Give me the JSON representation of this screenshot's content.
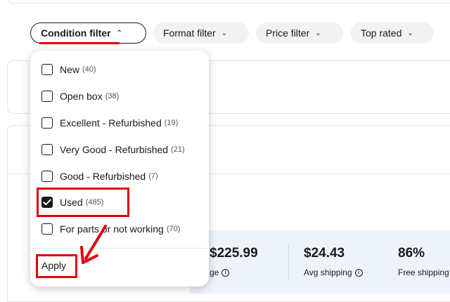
{
  "filters": [
    {
      "label": "Condition filter",
      "active": true
    },
    {
      "label": "Format filter",
      "active": false
    },
    {
      "label": "Price filter",
      "active": false
    },
    {
      "label": "Top rated",
      "active": false
    }
  ],
  "condition_options": [
    {
      "label": "New",
      "count": "(40)",
      "checked": false
    },
    {
      "label": "Open box",
      "count": "(38)",
      "checked": false
    },
    {
      "label": "Excellent - Refurbished",
      "count": "(19)",
      "checked": false
    },
    {
      "label": "Very Good - Refurbished",
      "count": "(21)",
      "checked": false
    },
    {
      "label": "Good - Refurbished",
      "count": "(7)",
      "checked": false
    },
    {
      "label": "Used",
      "count": "(485)",
      "checked": true
    },
    {
      "label": "For parts or not working",
      "count": "(70)",
      "checked": false
    }
  ],
  "apply_label": "Apply",
  "stats": [
    {
      "value": "$225.99",
      "label": "ge"
    },
    {
      "value": "$24.43",
      "label": "Avg shipping"
    },
    {
      "value": "86%",
      "label": "Free shipping"
    }
  ],
  "colors": {
    "annotation": "#e0000f",
    "stats_band": "#eef3fb",
    "chip_bg": "#f2f2f2"
  }
}
